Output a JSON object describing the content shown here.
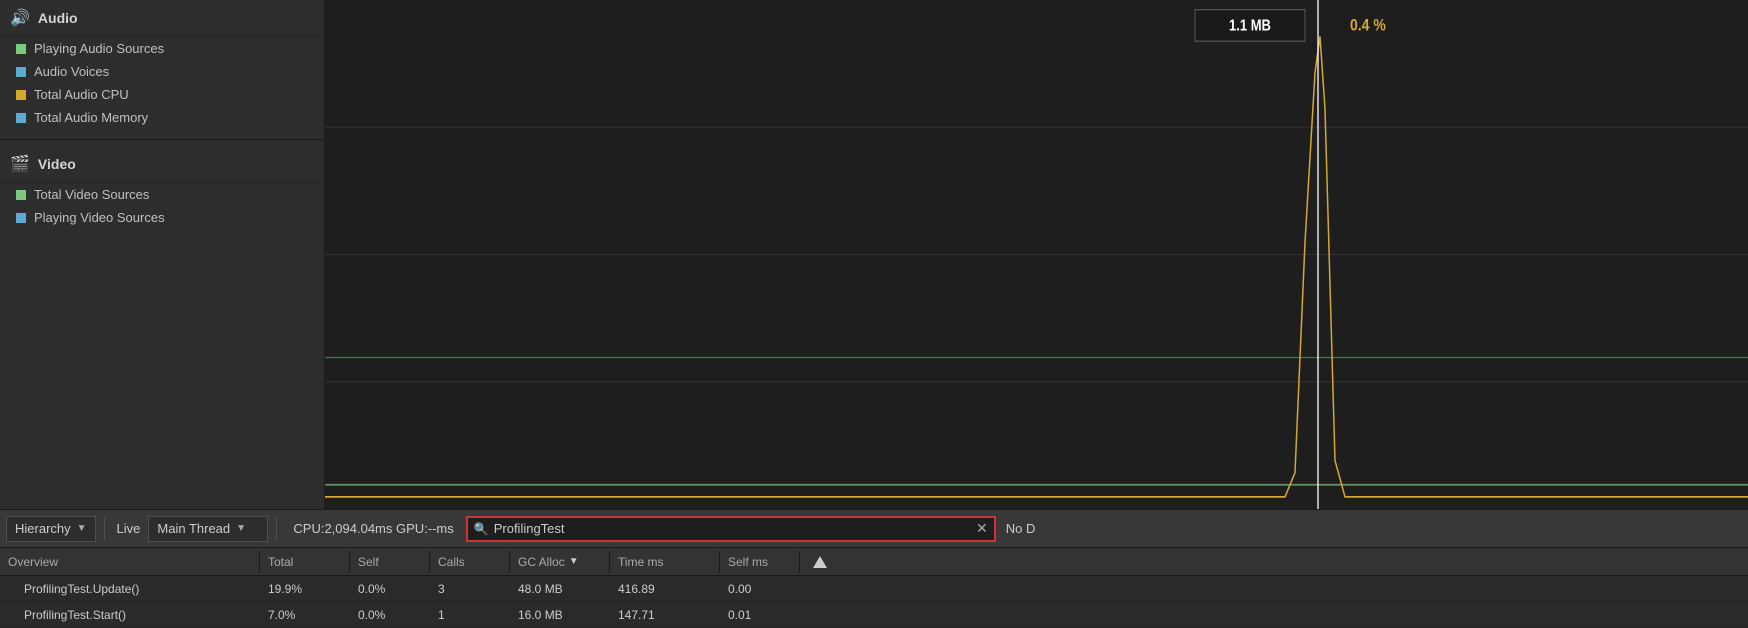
{
  "leftPanel": {
    "audioSection": {
      "header": "Audio",
      "headerIcon": "🔊",
      "items": [
        {
          "label": "Playing Audio Sources",
          "color": "#7ec87e",
          "shape": "square"
        },
        {
          "label": "Audio Voices",
          "color": "#5fa8d0",
          "shape": "square"
        },
        {
          "label": "Total Audio CPU",
          "color": "#d4a830",
          "shape": "square"
        },
        {
          "label": "Total Audio Memory",
          "color": "#5fa8d0",
          "shape": "square"
        }
      ]
    },
    "videoSection": {
      "header": "Video",
      "headerIcon": "🎬",
      "items": [
        {
          "label": "Total Video Sources",
          "color": "#7ec87e",
          "shape": "square"
        },
        {
          "label": "Playing Video Sources",
          "color": "#5fa8d0",
          "shape": "square"
        }
      ]
    }
  },
  "chart": {
    "tooltip": "1.1 MB",
    "tooltipPct": "0.4 %"
  },
  "toolbar": {
    "hierarchyLabel": "Hierarchy",
    "liveLabel": "Live",
    "mainThreadLabel": "Main Thread",
    "cpuStats": "CPU:2,094.04ms  GPU:--ms",
    "searchPlaceholder": "ProfilingTest",
    "searchValue": "ProfilingTest",
    "noDLabel": "No D"
  },
  "table": {
    "columns": [
      {
        "label": "Overview",
        "key": "overview"
      },
      {
        "label": "Total",
        "key": "total"
      },
      {
        "label": "Self",
        "key": "self"
      },
      {
        "label": "Calls",
        "key": "calls"
      },
      {
        "label": "GC Alloc",
        "key": "gcalloc",
        "sorted": true
      },
      {
        "label": "Time ms",
        "key": "timems"
      },
      {
        "label": "Self ms",
        "key": "selfms"
      },
      {
        "label": "",
        "key": "warn"
      }
    ],
    "rows": [
      {
        "overview": "ProfilingTest.Update()",
        "total": "19.9%",
        "self": "0.0%",
        "calls": "3",
        "gcalloc": "48.0 MB",
        "timems": "416.89",
        "selfms": "0.00",
        "warn": ""
      },
      {
        "overview": "ProfilingTest.Start()",
        "total": "7.0%",
        "self": "0.0%",
        "calls": "1",
        "gcalloc": "16.0 MB",
        "timems": "147.71",
        "selfms": "0.01",
        "warn": ""
      }
    ]
  }
}
